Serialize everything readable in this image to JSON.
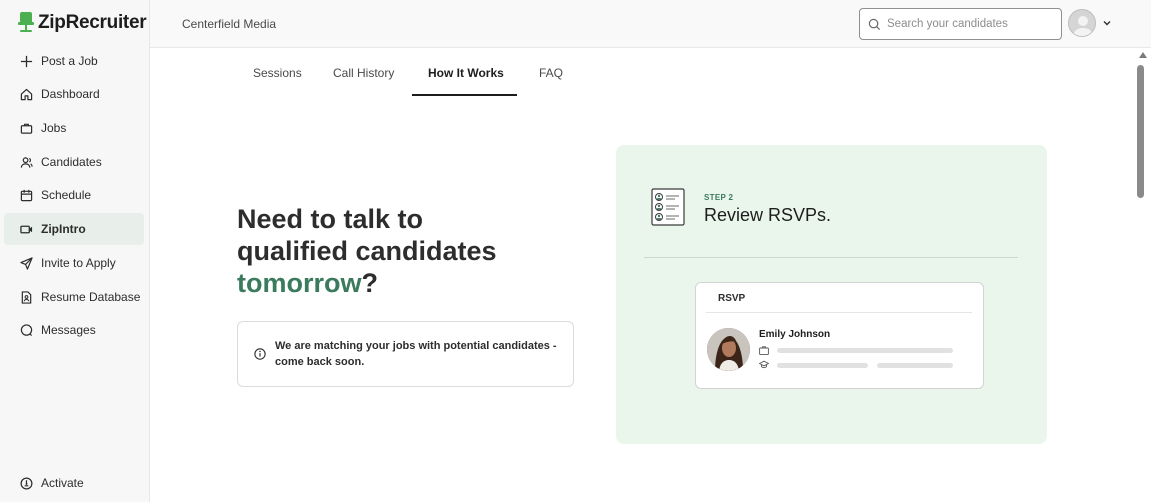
{
  "brand": {
    "name": "ZipRecruiter",
    "logo_icon": "chair-icon",
    "logo_color": "#4caf50"
  },
  "header": {
    "company": "Centerfield Media",
    "search": {
      "placeholder": "Search your candidates",
      "value": ""
    },
    "account_icon": "avatar-icon",
    "chevron_icon": "chevron-down-icon"
  },
  "sidebar": {
    "items": [
      {
        "label": "Post a Job",
        "icon": "plus-icon"
      },
      {
        "label": "Dashboard",
        "icon": "home-icon"
      },
      {
        "label": "Jobs",
        "icon": "briefcase-icon"
      },
      {
        "label": "Candidates",
        "icon": "users-icon"
      },
      {
        "label": "Schedule",
        "icon": "calendar-icon"
      },
      {
        "label": "ZipIntro",
        "icon": "video-icon",
        "active": true
      },
      {
        "label": "Invite to Apply",
        "icon": "send-icon"
      },
      {
        "label": "Resume Database",
        "icon": "document-icon"
      },
      {
        "label": "Messages",
        "icon": "message-icon"
      }
    ],
    "footer_item": {
      "label": "Activate",
      "icon": "activate-icon"
    }
  },
  "tabs": [
    {
      "label": "Sessions"
    },
    {
      "label": "Call History"
    },
    {
      "label": "How It Works",
      "active": true
    },
    {
      "label": "FAQ"
    }
  ],
  "main": {
    "headline_line1": "Need to talk to",
    "headline_line2": "qualified candidates",
    "headline_highlight": "tomorrow",
    "headline_suffix": "?",
    "notice": "We are matching your jobs with potential candidates - come back soon.",
    "accent_color": "#3b7a5c"
  },
  "step": {
    "label": "STEP 2",
    "title": "Review RSVPs.",
    "icon": "rsvp-list-icon",
    "card": {
      "title": "RSVP",
      "person_name": "Emily Johnson",
      "job_icon": "briefcase-icon",
      "education_icon": "graduation-cap-icon"
    }
  }
}
